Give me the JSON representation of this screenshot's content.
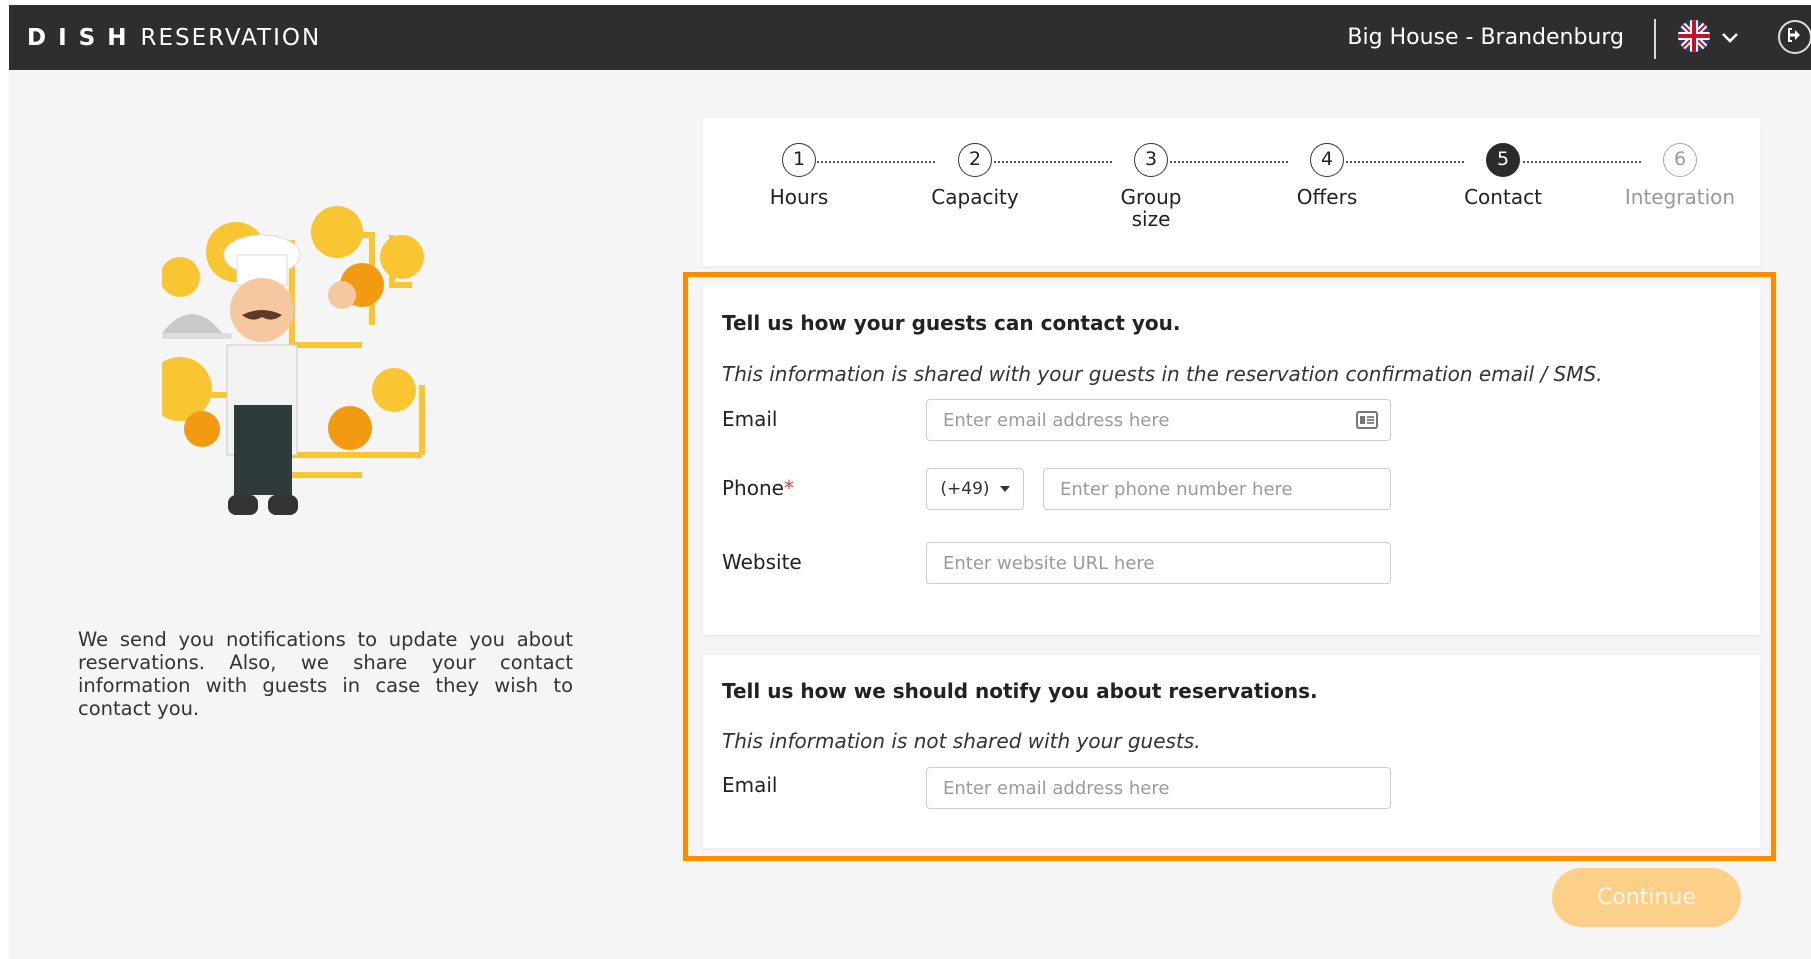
{
  "header": {
    "logo_bold": "DISH",
    "logo_light": "RESERVATION",
    "restaurant": "Big House - Brandenburg",
    "language_icon": "uk-flag-icon",
    "logout_icon": "logout-icon"
  },
  "steps": [
    {
      "number": "1",
      "label": "Hours",
      "state": "done"
    },
    {
      "number": "2",
      "label": "Capacity",
      "state": "done"
    },
    {
      "number": "3",
      "label": "Group size",
      "state": "done"
    },
    {
      "number": "4",
      "label": "Offers",
      "state": "done"
    },
    {
      "number": "5",
      "label": "Contact",
      "state": "active"
    },
    {
      "number": "6",
      "label": "Integration",
      "state": "disabled"
    }
  ],
  "sidebar": {
    "text": "We send you notifications to update you about reservations. Also, we share your contact information with guests in case they wish to contact you."
  },
  "contact_card": {
    "title": "Tell us how your guests can contact you.",
    "subtitle": "This information is shared with your guests in the reservation confirmation email / SMS.",
    "email_label": "Email",
    "email_placeholder": "Enter email address here",
    "phone_label": "Phone",
    "phone_required_mark": "*",
    "phone_code": "(+49)",
    "phone_placeholder": "Enter phone number here",
    "website_label": "Website",
    "website_placeholder": "Enter website URL here"
  },
  "notify_card": {
    "title": "Tell us how we should notify you about reservations.",
    "subtitle": "This information is not shared with your guests.",
    "email_label": "Email",
    "email_placeholder": "Enter email address here"
  },
  "continue_label": "Continue",
  "colors": {
    "header_bg": "#2e2e2e",
    "highlight": "#ff8c00",
    "continue_bg": "#fdd08a",
    "illustration_yellow": "#f9c533",
    "required": "#e53935"
  }
}
